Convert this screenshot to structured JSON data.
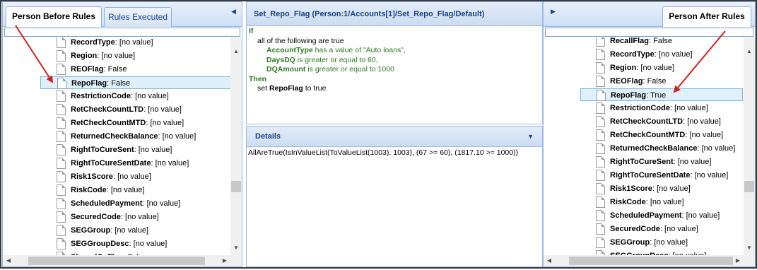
{
  "left_panel": {
    "tabs": [
      {
        "label": "Person Before Rules",
        "active": true
      },
      {
        "label": "Rules Executed",
        "active": false
      }
    ],
    "collapse_icon": "caret-left-icon",
    "items": [
      {
        "key": "RecordType",
        "value": "[no value]"
      },
      {
        "key": "Region",
        "value": "[no value]"
      },
      {
        "key": "REOFlag",
        "value": "False"
      },
      {
        "key": "RepoFlag",
        "value": "False",
        "selected": true
      },
      {
        "key": "RestrictionCode",
        "value": "[no value]"
      },
      {
        "key": "RetCheckCountLTD",
        "value": "[no value]"
      },
      {
        "key": "RetCheckCountMTD",
        "value": "[no value]"
      },
      {
        "key": "ReturnedCheckBalance",
        "value": "[no value]"
      },
      {
        "key": "RightToCureSent",
        "value": "[no value]"
      },
      {
        "key": "RightToCureSentDate",
        "value": "[no value]"
      },
      {
        "key": "Risk1Score",
        "value": "[no value]"
      },
      {
        "key": "RiskCode",
        "value": "[no value]"
      },
      {
        "key": "ScheduledPayment",
        "value": "[no value]"
      },
      {
        "key": "SecuredCode",
        "value": "[no value]"
      },
      {
        "key": "SEGGroup",
        "value": "[no value]"
      },
      {
        "key": "SEGGroupDesc",
        "value": "[no value]"
      },
      {
        "key": "SharedCoFlag",
        "value": "False"
      }
    ]
  },
  "rule_panel": {
    "title": "Set_Repo_Flag (Person:1/Accounts[1]/Set_Repo_Flag/Default)",
    "if_kw": "If",
    "all_line": "all of the following are true",
    "cond1_field": "AccountType",
    "cond1_rest": " has a value of \"Auto loans\",",
    "cond2_field": "DaysDQ",
    "cond2_rest": " is greater or equal to 60,",
    "cond3_field": "DQAmount",
    "cond3_rest": " is greater or equal to 1000",
    "then_kw": "Then",
    "action_pre": "set ",
    "action_field": "RepoFlag",
    "action_post": " to true"
  },
  "details_panel": {
    "title": "Details",
    "chevron_icon": "chevron-down-icon",
    "expression": "AllAreTrue(IsInValueList(ToValueList(1003), 1003), (67 >= 60), (1817.10 >= 1000))"
  },
  "right_panel": {
    "tabs": [
      {
        "label": "Person After Rules",
        "active": true
      }
    ],
    "collapse_icon": "caret-right-icon",
    "items": [
      {
        "key": "RecallFlag",
        "value": "False"
      },
      {
        "key": "RecordType",
        "value": "[no value]"
      },
      {
        "key": "Region",
        "value": "[no value]"
      },
      {
        "key": "REOFlag",
        "value": "False"
      },
      {
        "key": "RepoFlag",
        "value": "True",
        "selected": true
      },
      {
        "key": "RestrictionCode",
        "value": "[no value]"
      },
      {
        "key": "RetCheckCountLTD",
        "value": "[no value]"
      },
      {
        "key": "RetCheckCountMTD",
        "value": "[no value]"
      },
      {
        "key": "ReturnedCheckBalance",
        "value": "[no value]"
      },
      {
        "key": "RightToCureSent",
        "value": "[no value]"
      },
      {
        "key": "RightToCureSentDate",
        "value": "[no value]"
      },
      {
        "key": "Risk1Score",
        "value": "[no value]"
      },
      {
        "key": "RiskCode",
        "value": "[no value]"
      },
      {
        "key": "ScheduledPayment",
        "value": "[no value]"
      },
      {
        "key": "SecuredCode",
        "value": "[no value]"
      },
      {
        "key": "SEGGroup",
        "value": "[no value]"
      },
      {
        "key": "SEGGroupDesc",
        "value": "[no value]"
      }
    ]
  },
  "colors": {
    "arrow": "#cc1f1f",
    "selection": "#dff0fb",
    "header_text": "#15428b",
    "keyword": "#2c7a1f"
  }
}
